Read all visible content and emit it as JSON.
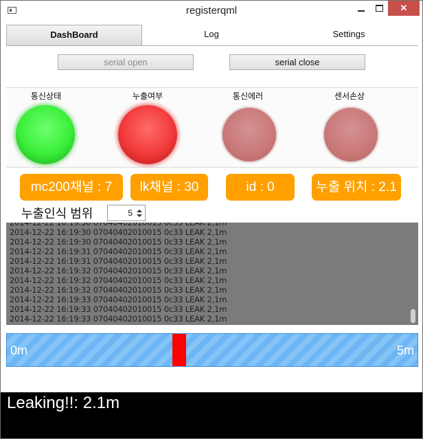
{
  "window": {
    "title": "registerqml",
    "minimize_glyph": "—",
    "close_glyph": "✕"
  },
  "tabs": [
    {
      "label": "DashBoard",
      "active": true
    },
    {
      "label": "Log",
      "active": false
    },
    {
      "label": "Settings",
      "active": false
    }
  ],
  "buttons": {
    "serial_open": "serial open",
    "serial_close": "serial close"
  },
  "indicators": [
    {
      "label": "통신상태",
      "state": "green"
    },
    {
      "label": "누출여부",
      "state": "red"
    },
    {
      "label": "통신에러",
      "state": "off"
    },
    {
      "label": "센서손상",
      "state": "off"
    }
  ],
  "badges": {
    "channel": "mc200채널 : 7",
    "lk_channel": "lk채널 : 30",
    "id": "id : 0",
    "leak_position": "누출 위치 : 2.1"
  },
  "range": {
    "label": "누출인식 범위",
    "value": "5"
  },
  "log_lines": [
    "2014-12-22 16:19:30 07040402010015 0c33 LEAK 2,1m",
    "2014-12-22 16:19:30 07040402010015 0c33 LEAK 2,1m",
    "2014-12-22 16:19:30 07040402010015 0c33 LEAK 2,1m",
    "2014-12-22 16:19:31 07040402010015 0c33 LEAK 2,1m",
    "2014-12-22 16:19:31 07040402010015 0c33 LEAK 2,1m",
    "2014-12-22 16:19:32 07040402010015 0c33 LEAK 2,1m",
    "2014-12-22 16:19:32 07040402010015 0c33 LEAK 2,1m",
    "2014-12-22 16:19:32 07040402010015 0c33 LEAK 2,1m",
    "2014-12-22 16:19:33 07040402010015 0c33 LEAK 2,1m",
    "2014-12-22 16:19:33 07040402010015 0c33 LEAK 2,1m",
    "2014-12-22 16:19:33 07040402010015 0c33 LEAK 2,1m",
    "2014-12-22 16:19:34 07040402010015 0c33 LEAK 2,1m"
  ],
  "track": {
    "start_label": "0m",
    "end_label": "5m",
    "leak_position_m": 2.1,
    "length_m": 5,
    "marker_color": "#ff0000"
  },
  "status": {
    "text": "Leaking!!: 2.1m"
  },
  "colors": {
    "badge": "#ffa000",
    "status_bg": "#000000",
    "track": "#6cb6f3"
  }
}
